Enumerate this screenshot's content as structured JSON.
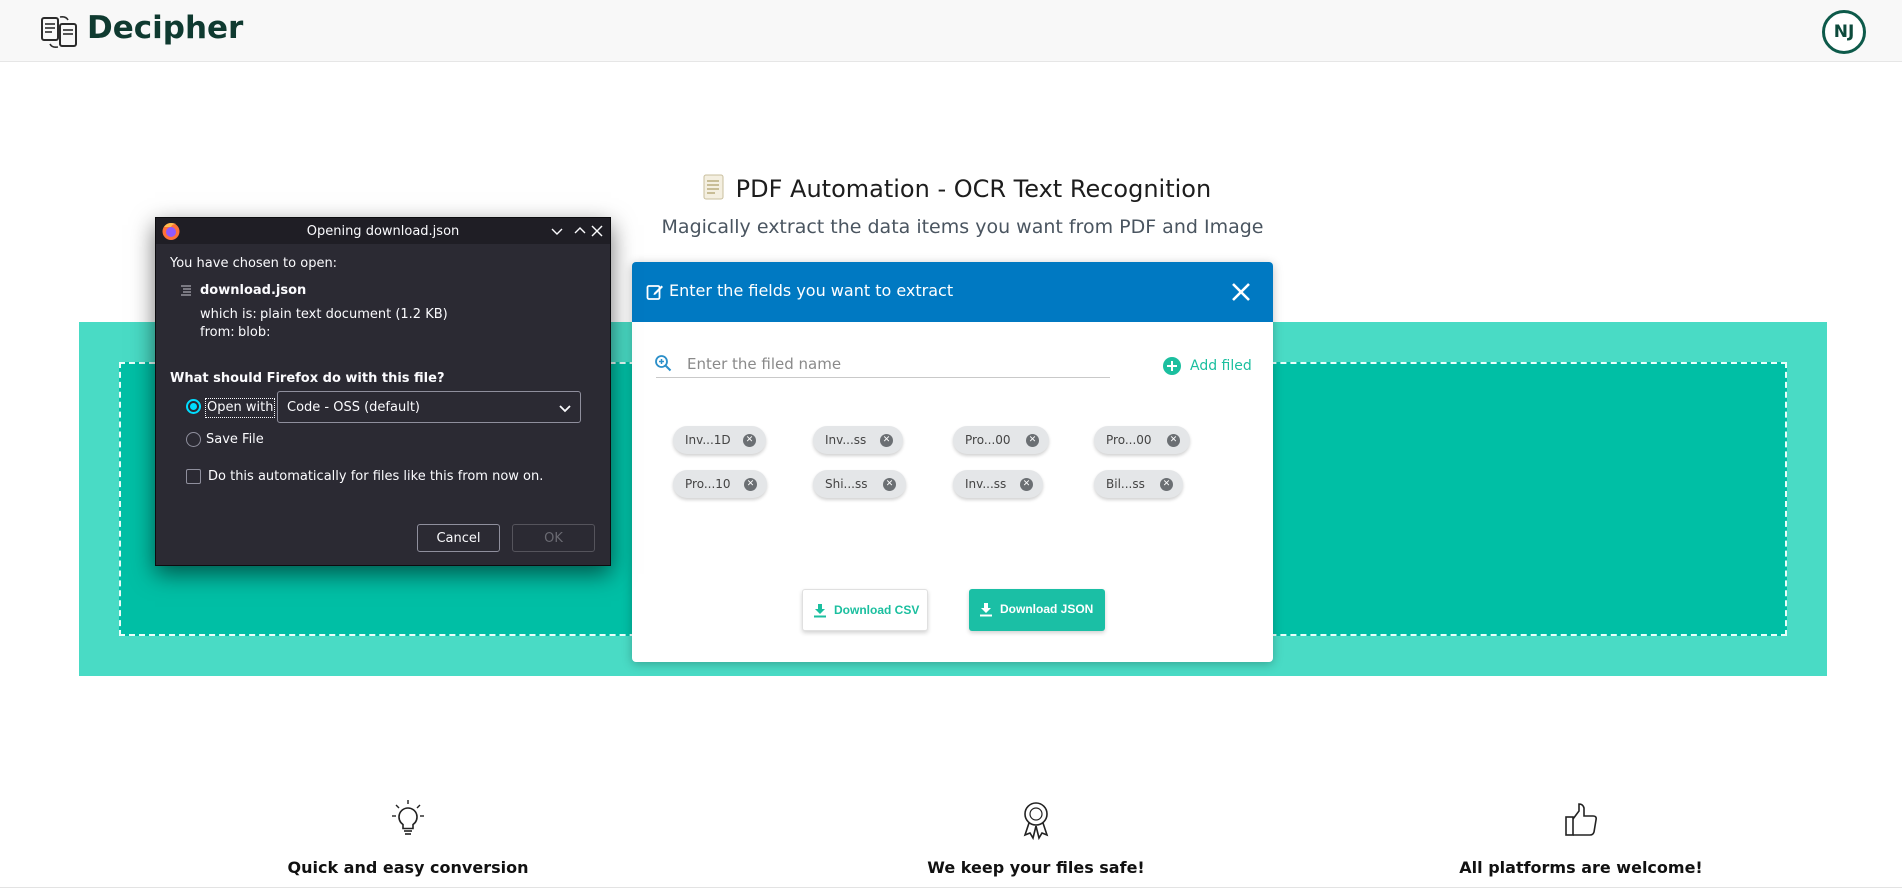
{
  "app": {
    "brand": "Decipher",
    "avatar_initials": "NJ"
  },
  "hero": {
    "title": "PDF Automation - OCR Text Recognition",
    "subtitle": "Magically extract the data items you want from PDF and Image"
  },
  "panel": {
    "header_title": "Enter the fields you want to extract",
    "field_placeholder": "Enter the filed name",
    "add_label": "Add filed",
    "chips": [
      "Inv...1D",
      "Inv...ss",
      "Pro...00",
      "Pro...00",
      "Pro...10",
      "Shi...ss",
      "Inv...ss",
      "Bil...ss"
    ],
    "download_csv": "Download CSV",
    "download_json": "Download JSON"
  },
  "dialog": {
    "title": "Opening download.json",
    "intro": "You have chosen to open:",
    "filename": "download.json",
    "which_is_label": "which is:",
    "which_is_value": "plain text document (1.2 KB)",
    "from_label": "from:",
    "from_value": "blob:",
    "question": "What should Firefox do with this file?",
    "open_with_label": "Open with",
    "open_with_app": "Code - OSS (default)",
    "save_file_label": "Save File",
    "auto_label": "Do this automatically for files like this from now on.",
    "cancel": "Cancel",
    "ok": "OK"
  },
  "features": [
    {
      "icon": "lightbulb-icon",
      "label": "Quick and easy conversion"
    },
    {
      "icon": "award-ribbon-icon",
      "label": "We keep your files safe!"
    },
    {
      "icon": "thumbs-up-icon",
      "label": "All platforms are welcome!"
    }
  ],
  "colors": {
    "band": "#49dbc5",
    "dropzone": "#00bfa5",
    "panel_header": "#0079c2",
    "accent": "#1bbf9f",
    "dialog_bg": "#2b2a33"
  }
}
